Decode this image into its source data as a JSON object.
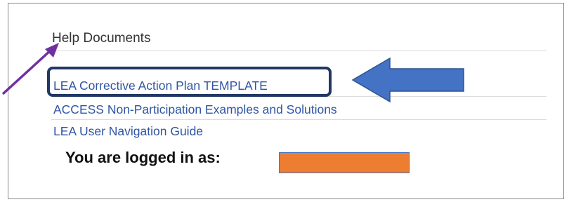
{
  "help_documents": {
    "title": "Help Documents",
    "links": [
      {
        "label": "LEA Corrective Action Plan TEMPLATE"
      },
      {
        "label": "ACCESS Non-Participation Examples and Solutions"
      },
      {
        "label": "LEA User Navigation Guide"
      }
    ]
  },
  "login_status": {
    "label": "You are logged in as:"
  },
  "colors": {
    "link": "#2f55a4",
    "highlight_border": "#203864",
    "blue_arrow": "#4472c4",
    "purple_arrow": "#7030a0",
    "redaction": "#ed7d31"
  },
  "annotations": {
    "blue_arrow_icon": "arrow-left-icon",
    "purple_arrow_icon": "arrow-up-right-icon",
    "redaction": "redaction-box"
  }
}
